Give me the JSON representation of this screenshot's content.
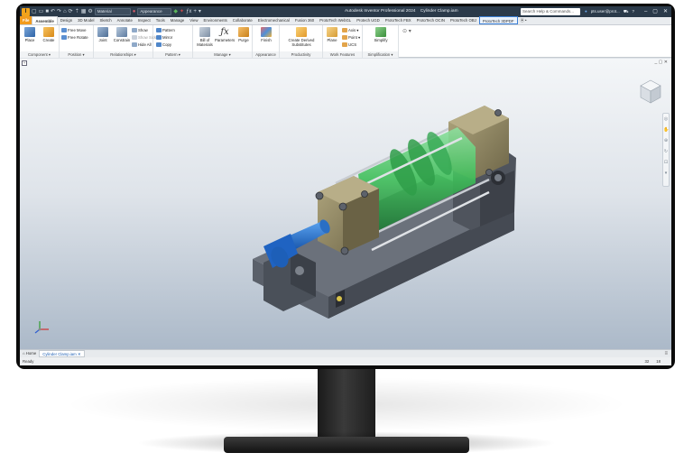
{
  "window": {
    "title": "Autodesk Inventor Professional 2024",
    "document": "Cylinder Clamp.iam",
    "search_placeholder": "Search Help & Commands...",
    "user": "pts.user@prot...",
    "help": "?"
  },
  "qat": {
    "material": "Material",
    "appearance": "Appearance"
  },
  "tabs": [
    {
      "label": "File"
    },
    {
      "label": "Assemble"
    },
    {
      "label": "Design"
    },
    {
      "label": "3D Model"
    },
    {
      "label": "Sketch"
    },
    {
      "label": "Annotate"
    },
    {
      "label": "Inspect"
    },
    {
      "label": "Tools"
    },
    {
      "label": "Manage"
    },
    {
      "label": "View"
    },
    {
      "label": "Environments"
    },
    {
      "label": "Collaborate"
    },
    {
      "label": "Electromechanical"
    },
    {
      "label": "Fusion 360"
    },
    {
      "label": "ProtoTech WebGL"
    },
    {
      "label": "Protech UGD"
    },
    {
      "label": "ProtoTech FBX"
    },
    {
      "label": "ProtoTech OCIN"
    },
    {
      "label": "ProtoTech OBJ"
    },
    {
      "label": "ProtoTech 3DPDF"
    },
    {
      "label": "⦿ •"
    }
  ],
  "ribbon": {
    "component": {
      "label": "Component ▾",
      "place": "Place",
      "create": "Create"
    },
    "position": {
      "label": "Position ▾",
      "free_move": "Free Move",
      "free_rotate": "Free Rotate"
    },
    "relationships": {
      "label": "Relationships ▾",
      "joint": "Joint",
      "constrain": "Constrain",
      "show": "Show",
      "show_sick": "Show Sick",
      "hide_all": "Hide All"
    },
    "pattern": {
      "label": "Pattern ▾",
      "pattern": "Pattern",
      "mirror": "Mirror",
      "copy": "Copy"
    },
    "manage": {
      "label": "Manage ▾",
      "bom": "Bill of Materials",
      "parameters": "Parameters",
      "purge": "Purge"
    },
    "appearance": {
      "label": "Appearance",
      "finish": "Finish"
    },
    "productivity": {
      "label": "Productivity",
      "create_derived": "Create Derived Substitutes"
    },
    "work_features": {
      "label": "Work Features",
      "plane": "Plane",
      "axis": "Axis ▾",
      "point": "Point ▾",
      "ucs": "UCS"
    },
    "simplification": {
      "label": "Simplification ▾",
      "simplify": "Simplify"
    }
  },
  "doc_tabs": {
    "home": "Home",
    "active": "Cylinder Clamp.iam",
    "close": "✕"
  },
  "status": {
    "left": "Ready",
    "n1": "32",
    "n2": "18"
  },
  "colors": {
    "title_bar": "#2b3a4a",
    "file_tab": "#f29b1d",
    "part_gray": "#505660",
    "part_blue": "#1f6fd1",
    "part_green": "#3fbf5a",
    "part_khaki": "#8e8462"
  }
}
